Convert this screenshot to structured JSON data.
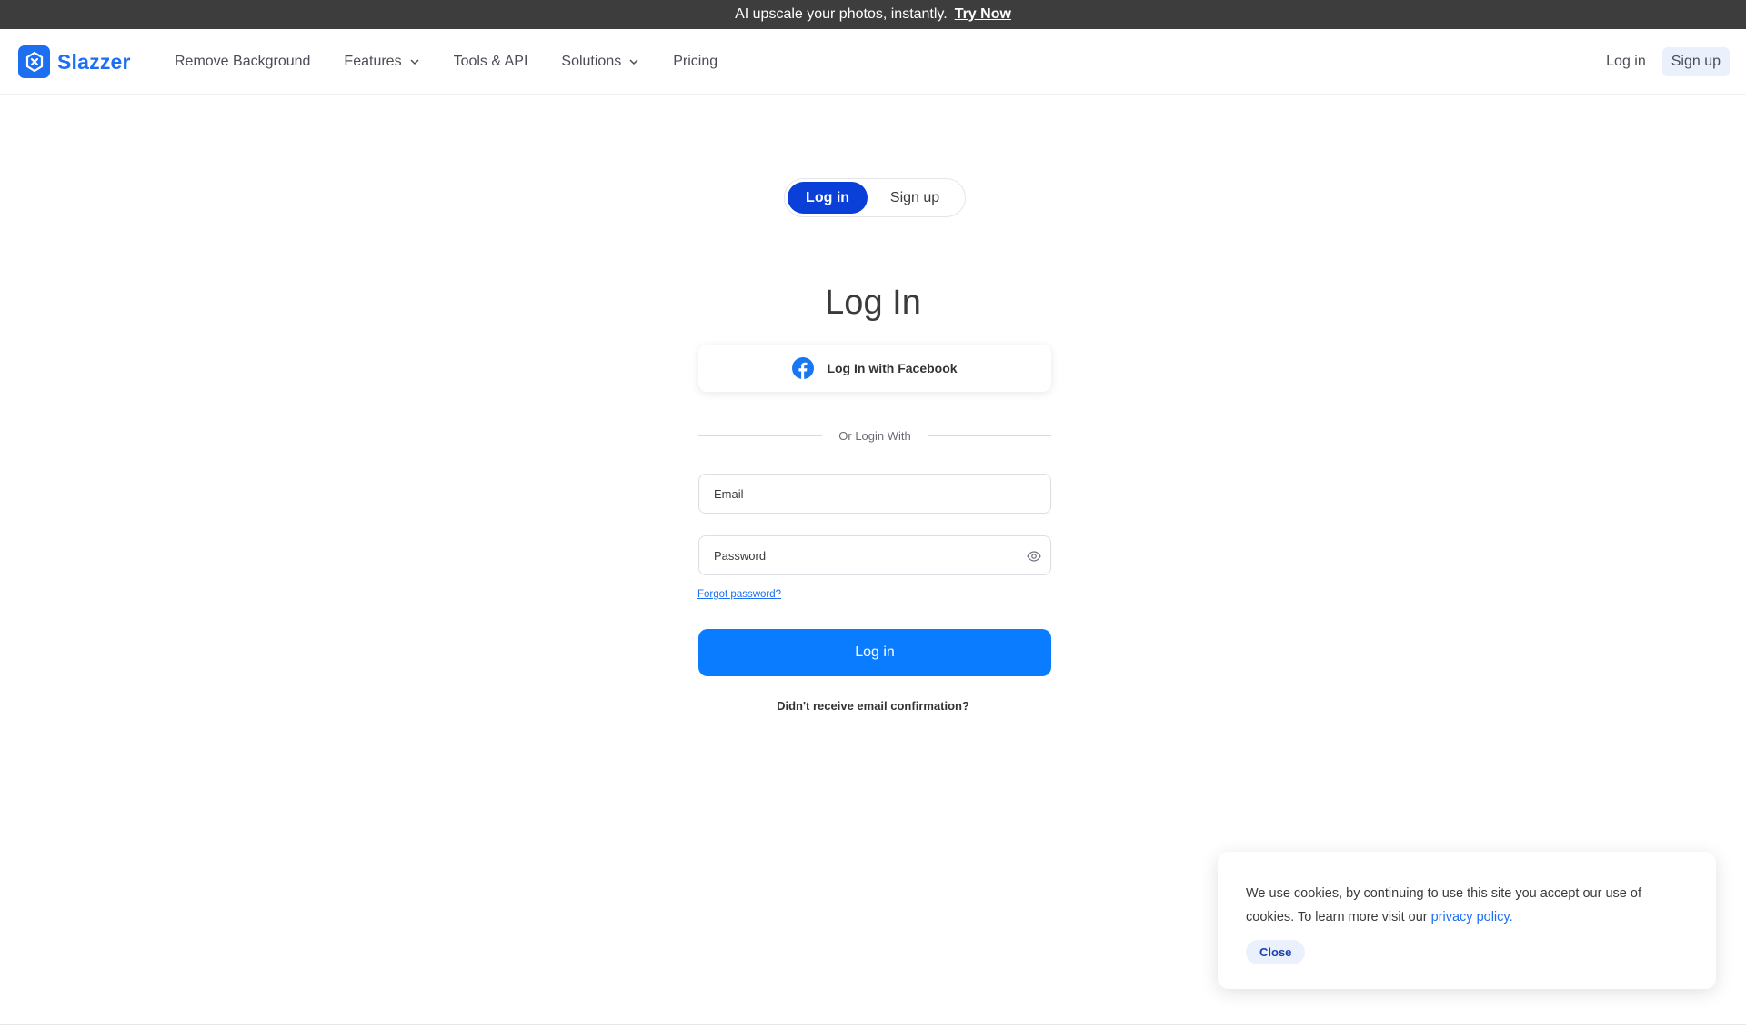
{
  "promo": {
    "text": "AI upscale your photos, instantly.",
    "link": "Try Now"
  },
  "brand": {
    "name": "Slazzer",
    "color": "#1d6ff2",
    "logo_icon": "slazzer-logo-icon"
  },
  "nav": {
    "items": [
      {
        "label": "Remove Background",
        "dropdown": false
      },
      {
        "label": "Features",
        "dropdown": true
      },
      {
        "label": "Tools & API",
        "dropdown": false
      },
      {
        "label": "Solutions",
        "dropdown": true
      },
      {
        "label": "Pricing",
        "dropdown": false
      }
    ],
    "login": "Log in",
    "signup": "Sign up"
  },
  "toggle": {
    "login": "Log in",
    "signup": "Sign up",
    "active": "login"
  },
  "form": {
    "title": "Log In",
    "facebook": "Log In with Facebook",
    "divider": "Or Login With",
    "email_placeholder": "Email",
    "password_placeholder": "Password",
    "forgot": "Forgot password?",
    "submit": "Log in",
    "resend": "Didn't receive email confirmation?"
  },
  "cookie": {
    "text": "We use cookies, by continuing to use this site you accept our use of cookies.  To learn more visit our ",
    "link": "privacy policy.",
    "close": "Close"
  },
  "colors": {
    "primary": "#0a7cff",
    "toggle_active": "#0a3fd8",
    "facebook": "#1877f2",
    "promo_bg": "#3d3d3d"
  }
}
